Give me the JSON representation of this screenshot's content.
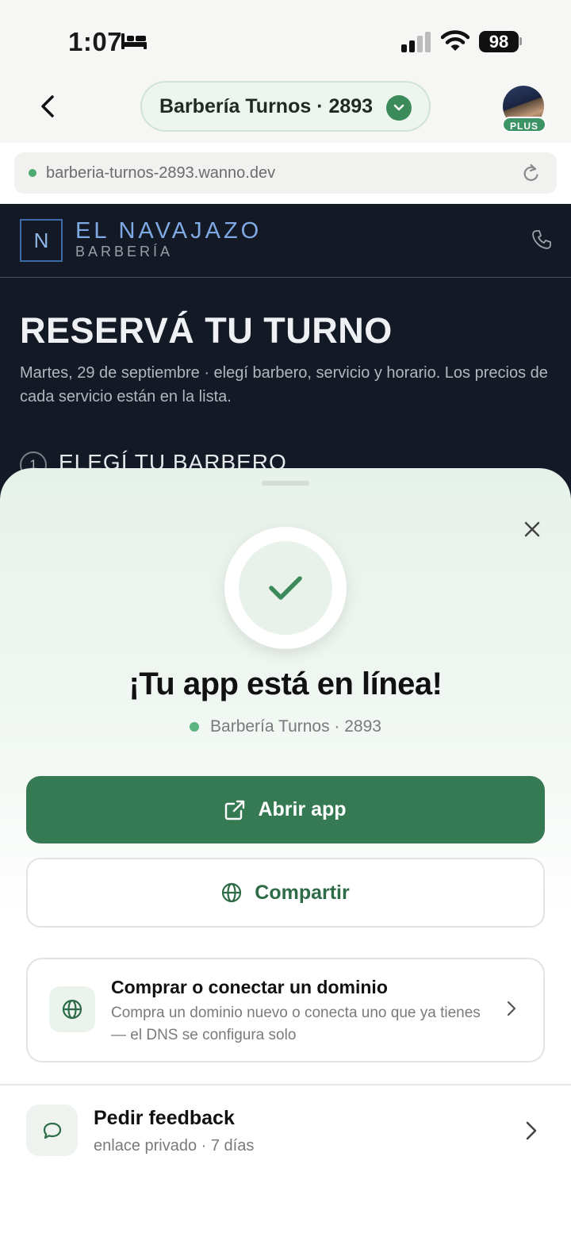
{
  "status_bar": {
    "time": "1:07",
    "battery": "98"
  },
  "header": {
    "project_name": "Barbería Turnos · 2893",
    "badge": "PLUS"
  },
  "url_bar": {
    "url": "barberia-turnos-2893.wanno.dev"
  },
  "site_preview": {
    "logo_letter": "N",
    "brand_name": "EL NAVAJAZO",
    "brand_sub": "BARBERÍA",
    "title": "RESERVÁ TU TURNO",
    "description": "Martes, 29 de septiembre · elegí barbero, servicio y horario. Los precios de cada servicio están en la lista.",
    "step_number": "1",
    "step_title": "ELEGÍ TU BARBERO"
  },
  "sheet": {
    "title": "¡Tu app está en línea!",
    "subtitle": "Barbería Turnos · 2893",
    "open_button": "Abrir app",
    "share_button": "Compartir",
    "domain_card": {
      "title": "Comprar o conectar un dominio",
      "description": "Compra un dominio nuevo o conecta uno que ya tienes — el DNS se configura solo"
    },
    "feedback": {
      "title": "Pedir feedback",
      "subtitle": "enlace privado · 7 días"
    }
  },
  "colors": {
    "accent_green": "#357a52",
    "site_bg": "#141a25",
    "brand_blue": "#7fa9e4"
  },
  "icons": [
    "bed-icon",
    "signal-icon",
    "wifi-icon",
    "back-icon",
    "chevron-down-icon",
    "reload-icon",
    "phone-icon",
    "close-icon",
    "check-icon",
    "external-link-icon",
    "globe-icon",
    "chevron-right-icon",
    "chat-bubble-icon"
  ]
}
